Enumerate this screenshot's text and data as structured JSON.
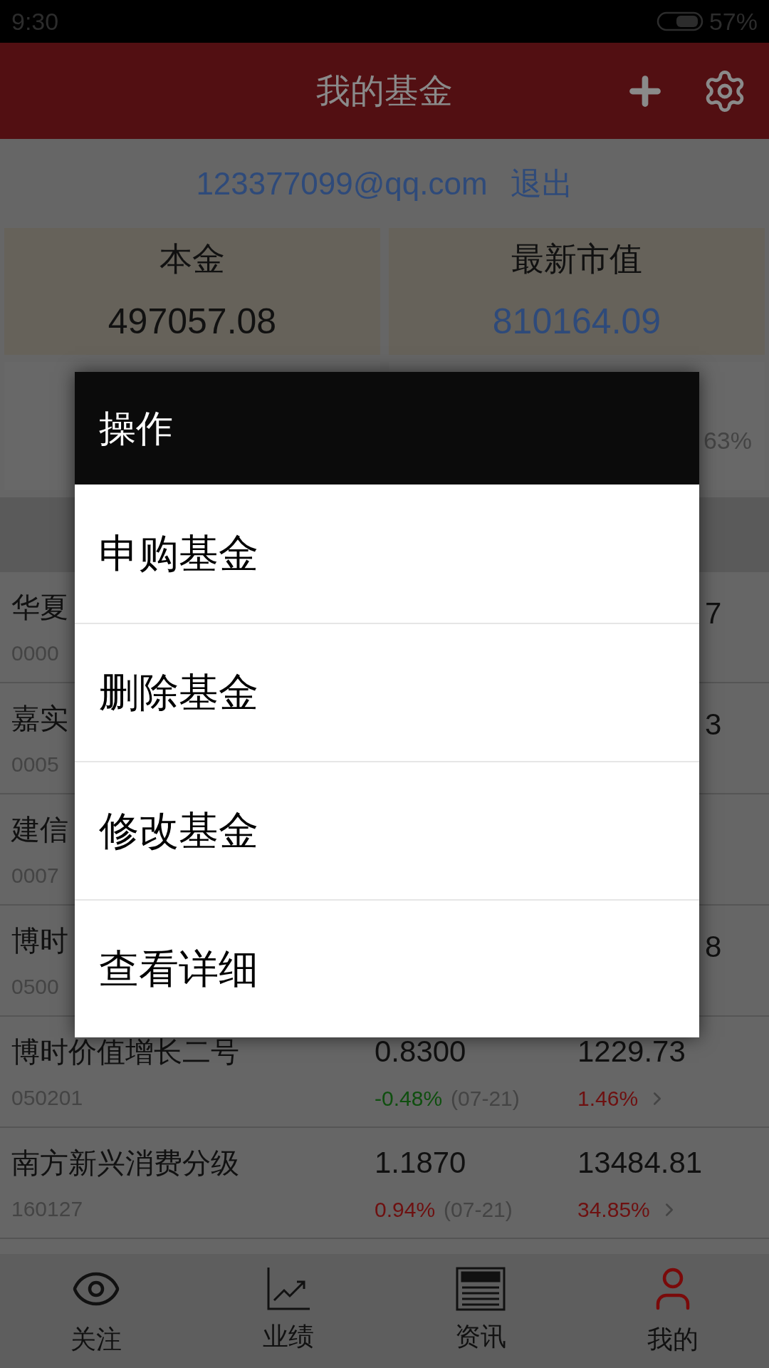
{
  "status_bar": {
    "time": "9:30",
    "battery": "57%"
  },
  "header": {
    "title": "我的基金"
  },
  "account": {
    "email": "123377099@qq.com",
    "logout": "退出"
  },
  "summary_cards": [
    {
      "label": "本金",
      "value": "497057.08",
      "color": "#111111"
    },
    {
      "label": "最新市值",
      "value": "810164.09",
      "color": "#2e4a7a"
    }
  ],
  "covered_card_fragment": "63%",
  "fund_rows": [
    {
      "kind": "partial",
      "name": "华夏",
      "code": "0000",
      "value": "7"
    },
    {
      "kind": "partial",
      "name": "嘉实",
      "code": "0005",
      "value": "3"
    },
    {
      "kind": "partial",
      "name": "建信",
      "code": "0007"
    },
    {
      "kind": "partial",
      "name": "博时",
      "code": "0500",
      "value": "8"
    },
    {
      "kind": "full",
      "name": "博时价值增长二号",
      "code": "050201",
      "nav": "0.8300",
      "change": {
        "text": "-0.48%",
        "color": "#0f4f0f"
      },
      "date": "(07-21)",
      "value": "1229.73",
      "return": {
        "text": "1.46%",
        "color": "#6e1010"
      }
    },
    {
      "kind": "full",
      "name": "南方新兴消费分级",
      "code": "160127",
      "nav": "1.1870",
      "change": {
        "text": "0.94%",
        "color": "#6e1010"
      },
      "date": "(07-21)",
      "value": "13484.81",
      "return": {
        "text": "34.85%",
        "color": "#6e1010"
      }
    }
  ],
  "dialog": {
    "title": "操作",
    "items": [
      "申购基金",
      "删除基金",
      "修改基金",
      "查看详细"
    ]
  },
  "tabs": [
    {
      "label": "关注",
      "selected": false
    },
    {
      "label": "业绩",
      "selected": false
    },
    {
      "label": "资讯",
      "selected": false
    },
    {
      "label": "我的",
      "selected": true
    }
  ]
}
